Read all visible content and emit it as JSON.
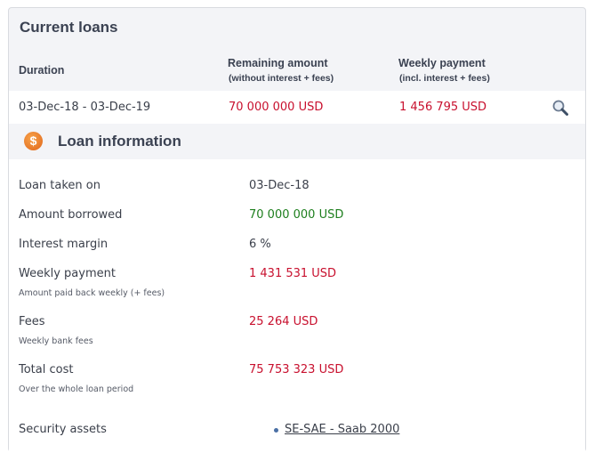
{
  "current_loans": {
    "title": "Current loans",
    "headers": {
      "duration": "Duration",
      "remaining": "Remaining amount",
      "remaining_sub": "(without interest + fees)",
      "weekly": "Weekly payment",
      "weekly_sub": "(incl. interest + fees)"
    },
    "rows": [
      {
        "duration": "03-Dec-18 - 03-Dec-19",
        "remaining": "70 000 000 USD",
        "weekly": "1 456 795 USD",
        "icon": "magnifier-icon"
      }
    ]
  },
  "loan_info": {
    "title": "Loan information",
    "icon": "dollar-coin-icon",
    "fields": {
      "taken_on": {
        "label": "Loan taken on",
        "value": "03-Dec-18"
      },
      "borrowed": {
        "label": "Amount borrowed",
        "value": "70 000 000 USD"
      },
      "margin": {
        "label": "Interest margin",
        "value": "6 %"
      },
      "weekly": {
        "label": "Weekly payment",
        "sub": "Amount paid back weekly (+ fees)",
        "value": "1 431 531 USD"
      },
      "fees": {
        "label": "Fees",
        "sub": "Weekly bank fees",
        "value": "25 264 USD"
      },
      "total": {
        "label": "Total cost",
        "sub": "Over the whole loan period",
        "value": "75 753 323 USD"
      },
      "security": {
        "label": "Security assets",
        "items": [
          "SE-SAE - Saab 2000"
        ]
      }
    }
  },
  "colors": {
    "negative": "#c8102e",
    "positive": "#1e7f1e",
    "panel_bg": "#f3f4f7"
  }
}
